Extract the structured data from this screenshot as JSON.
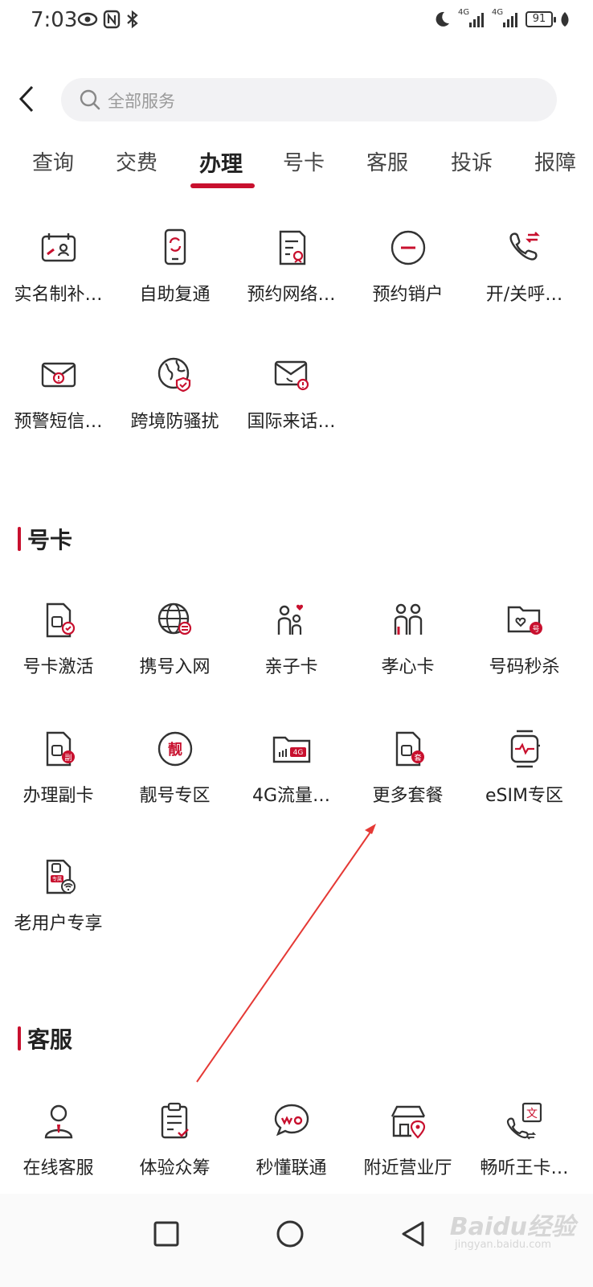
{
  "status_bar": {
    "time": "7:03",
    "battery": "91",
    "network_label_1": "4G",
    "network_label_2": "4G"
  },
  "search": {
    "placeholder": "全部服务"
  },
  "tabs": [
    {
      "label": "查询"
    },
    {
      "label": "交费"
    },
    {
      "label": "办理"
    },
    {
      "label": "号卡"
    },
    {
      "label": "客服"
    },
    {
      "label": "投诉"
    },
    {
      "label": "报障"
    }
  ],
  "active_tab": "办理",
  "handle_section": {
    "items": [
      {
        "label": "实名制补…",
        "icon": "id-card-icon"
      },
      {
        "label": "自助复通",
        "icon": "phone-restore-icon"
      },
      {
        "label": "预约网络…",
        "icon": "document-check-icon"
      },
      {
        "label": "预约销户",
        "icon": "minus-circle-icon"
      },
      {
        "label": "开/关呼…",
        "icon": "call-transfer-icon"
      },
      {
        "label": "预警短信…",
        "icon": "alert-mail-icon"
      },
      {
        "label": "跨境防骚扰",
        "icon": "globe-shield-icon"
      },
      {
        "label": "国际来话…",
        "icon": "mail-phone-icon"
      }
    ]
  },
  "card_section": {
    "title": "号卡",
    "items": [
      {
        "label": "号卡激活",
        "icon": "sim-check-icon"
      },
      {
        "label": "携号入网",
        "icon": "globe-transfer-icon"
      },
      {
        "label": "亲子卡",
        "icon": "parent-child-icon"
      },
      {
        "label": "孝心卡",
        "icon": "elder-care-icon"
      },
      {
        "label": "号码秒杀",
        "icon": "number-folder-icon"
      },
      {
        "label": "办理副卡",
        "icon": "sim-sub-icon"
      },
      {
        "label": "靓号专区",
        "icon": "pretty-number-icon"
      },
      {
        "label": "4G流量…",
        "icon": "4g-folder-icon"
      },
      {
        "label": "更多套餐",
        "icon": "sim-package-icon"
      },
      {
        "label": "eSIM专区",
        "icon": "smartwatch-icon"
      },
      {
        "label": "老用户专享",
        "icon": "sim-wifi-icon"
      }
    ],
    "badges": {
      "sub": "副",
      "pretty": "靓",
      "package": "套",
      "num": "号",
      "exclusive": "专属",
      "fourg": "4G"
    }
  },
  "service_section": {
    "title": "客服",
    "items": [
      {
        "label": "在线客服",
        "icon": "agent-icon"
      },
      {
        "label": "体验众筹",
        "icon": "clipboard-icon"
      },
      {
        "label": "秒懂联通",
        "icon": "chat-wo-icon"
      },
      {
        "label": "附近营业厅",
        "icon": "store-location-icon"
      },
      {
        "label": "畅听王卡…",
        "icon": "listen-text-icon"
      }
    ],
    "badges": {
      "text": "文"
    }
  },
  "watermark": {
    "text": "Baidu经验",
    "sub": "jingyan.baidu.com"
  },
  "colors": {
    "accent": "#c8102e",
    "icon_stroke": "#333333"
  }
}
